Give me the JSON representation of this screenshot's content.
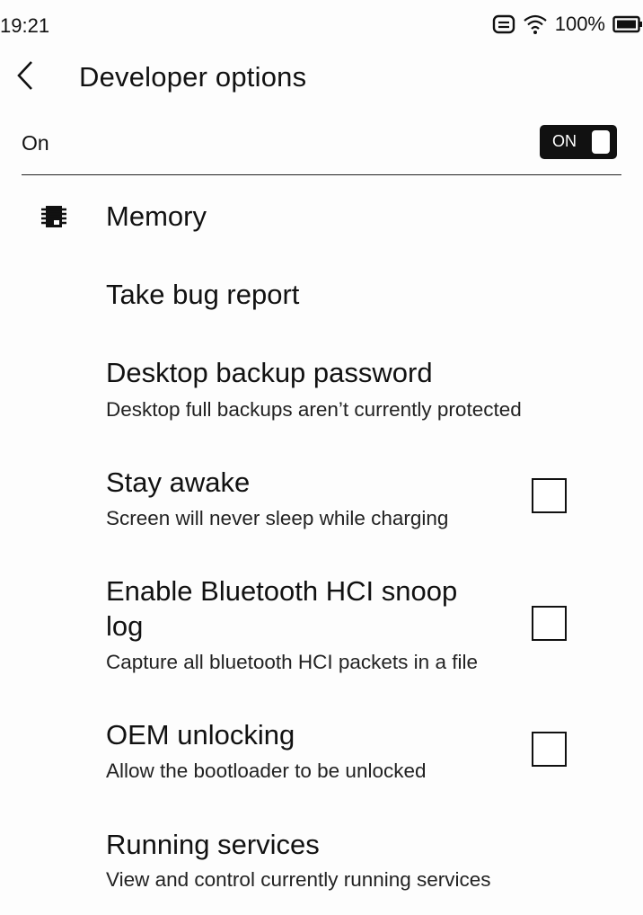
{
  "status_bar": {
    "time": "19:21",
    "battery_text": "100%",
    "icons": [
      "message-icon",
      "wifi-icon",
      "battery-icon"
    ]
  },
  "app_bar": {
    "back_icon": "chevron-left-icon",
    "title": "Developer options"
  },
  "master_switch": {
    "label": "On",
    "toggle_text": "ON",
    "checked": true
  },
  "items": [
    {
      "title": "Memory",
      "icon": "memory-chip-icon"
    },
    {
      "title": "Take bug report"
    },
    {
      "title": "Desktop backup password",
      "summary": "Desktop full backups aren’t currently protected"
    },
    {
      "title": "Stay awake",
      "summary": "Screen will never sleep while charging",
      "checked": false
    },
    {
      "title_line1": "Enable Bluetooth HCI snoop",
      "title_line2": "log",
      "summary": "Capture all bluetooth HCI packets in a file",
      "checked": false
    },
    {
      "title": "OEM unlocking",
      "summary": "Allow the bootloader to be unlocked",
      "checked": false
    },
    {
      "title": "Running services",
      "summary": "View and control currently running services"
    }
  ]
}
